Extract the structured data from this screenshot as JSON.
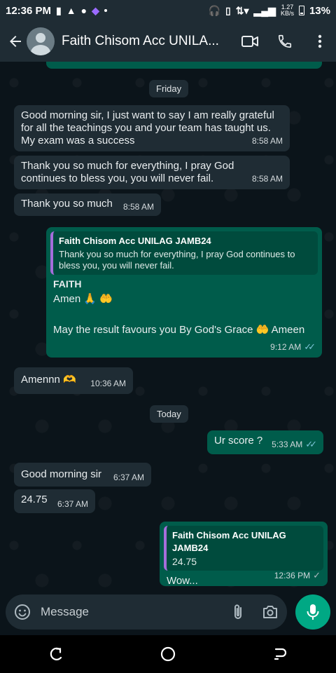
{
  "status_bar": {
    "time": "12:36 PM",
    "network_speed": "1.27",
    "network_unit": "KB/s",
    "battery": "13%"
  },
  "header": {
    "contact_name": "Faith Chisom Acc UNILA..."
  },
  "day_chips": {
    "friday": "Friday",
    "today": "Today"
  },
  "messages": [
    {
      "dir": "in",
      "text": "Good morning sir, I just want to say I am really grateful for all the teachings you and your team has taught us. My exam was a success",
      "time": "8:58 AM"
    },
    {
      "dir": "in",
      "text": "Thank you so much for everything, I pray God continues to bless you, you will never fail.",
      "time": "8:58 AM"
    },
    {
      "dir": "in",
      "text": "Thank you so much",
      "time": "8:58 AM"
    },
    {
      "dir": "out",
      "quote_author": "Faith Chisom Acc UNILAG JAMB24",
      "quote_text": "Thank you so much for everything, I pray God continues to bless you, you will never fail.",
      "sender": "FAITH",
      "line1": "Amen 🙏 🤲",
      "line2": "May the result favours you By God's Grace 🤲 Ameen",
      "time": "9:12 AM"
    },
    {
      "dir": "in",
      "text": "Amennn 🫶",
      "time": "10:36 AM"
    },
    {
      "dir": "out",
      "text": "Ur score ?",
      "time": "5:33 AM"
    },
    {
      "dir": "in",
      "text": "Good morning sir",
      "time": "6:37 AM"
    },
    {
      "dir": "in",
      "text": "24.75",
      "time": "6:37 AM"
    },
    {
      "dir": "out",
      "quote_author": "Faith Chisom Acc UNILAG JAMB24",
      "quote_text": "24.75",
      "text": "Wow...",
      "time": "12:36 PM"
    }
  ],
  "input": {
    "placeholder": "Message"
  },
  "colors": {
    "incoming_bubble": "#1f2c34",
    "outgoing_bubble": "#005c4b",
    "accent": "#00a884",
    "read_ticks": "#7ac3d6"
  }
}
